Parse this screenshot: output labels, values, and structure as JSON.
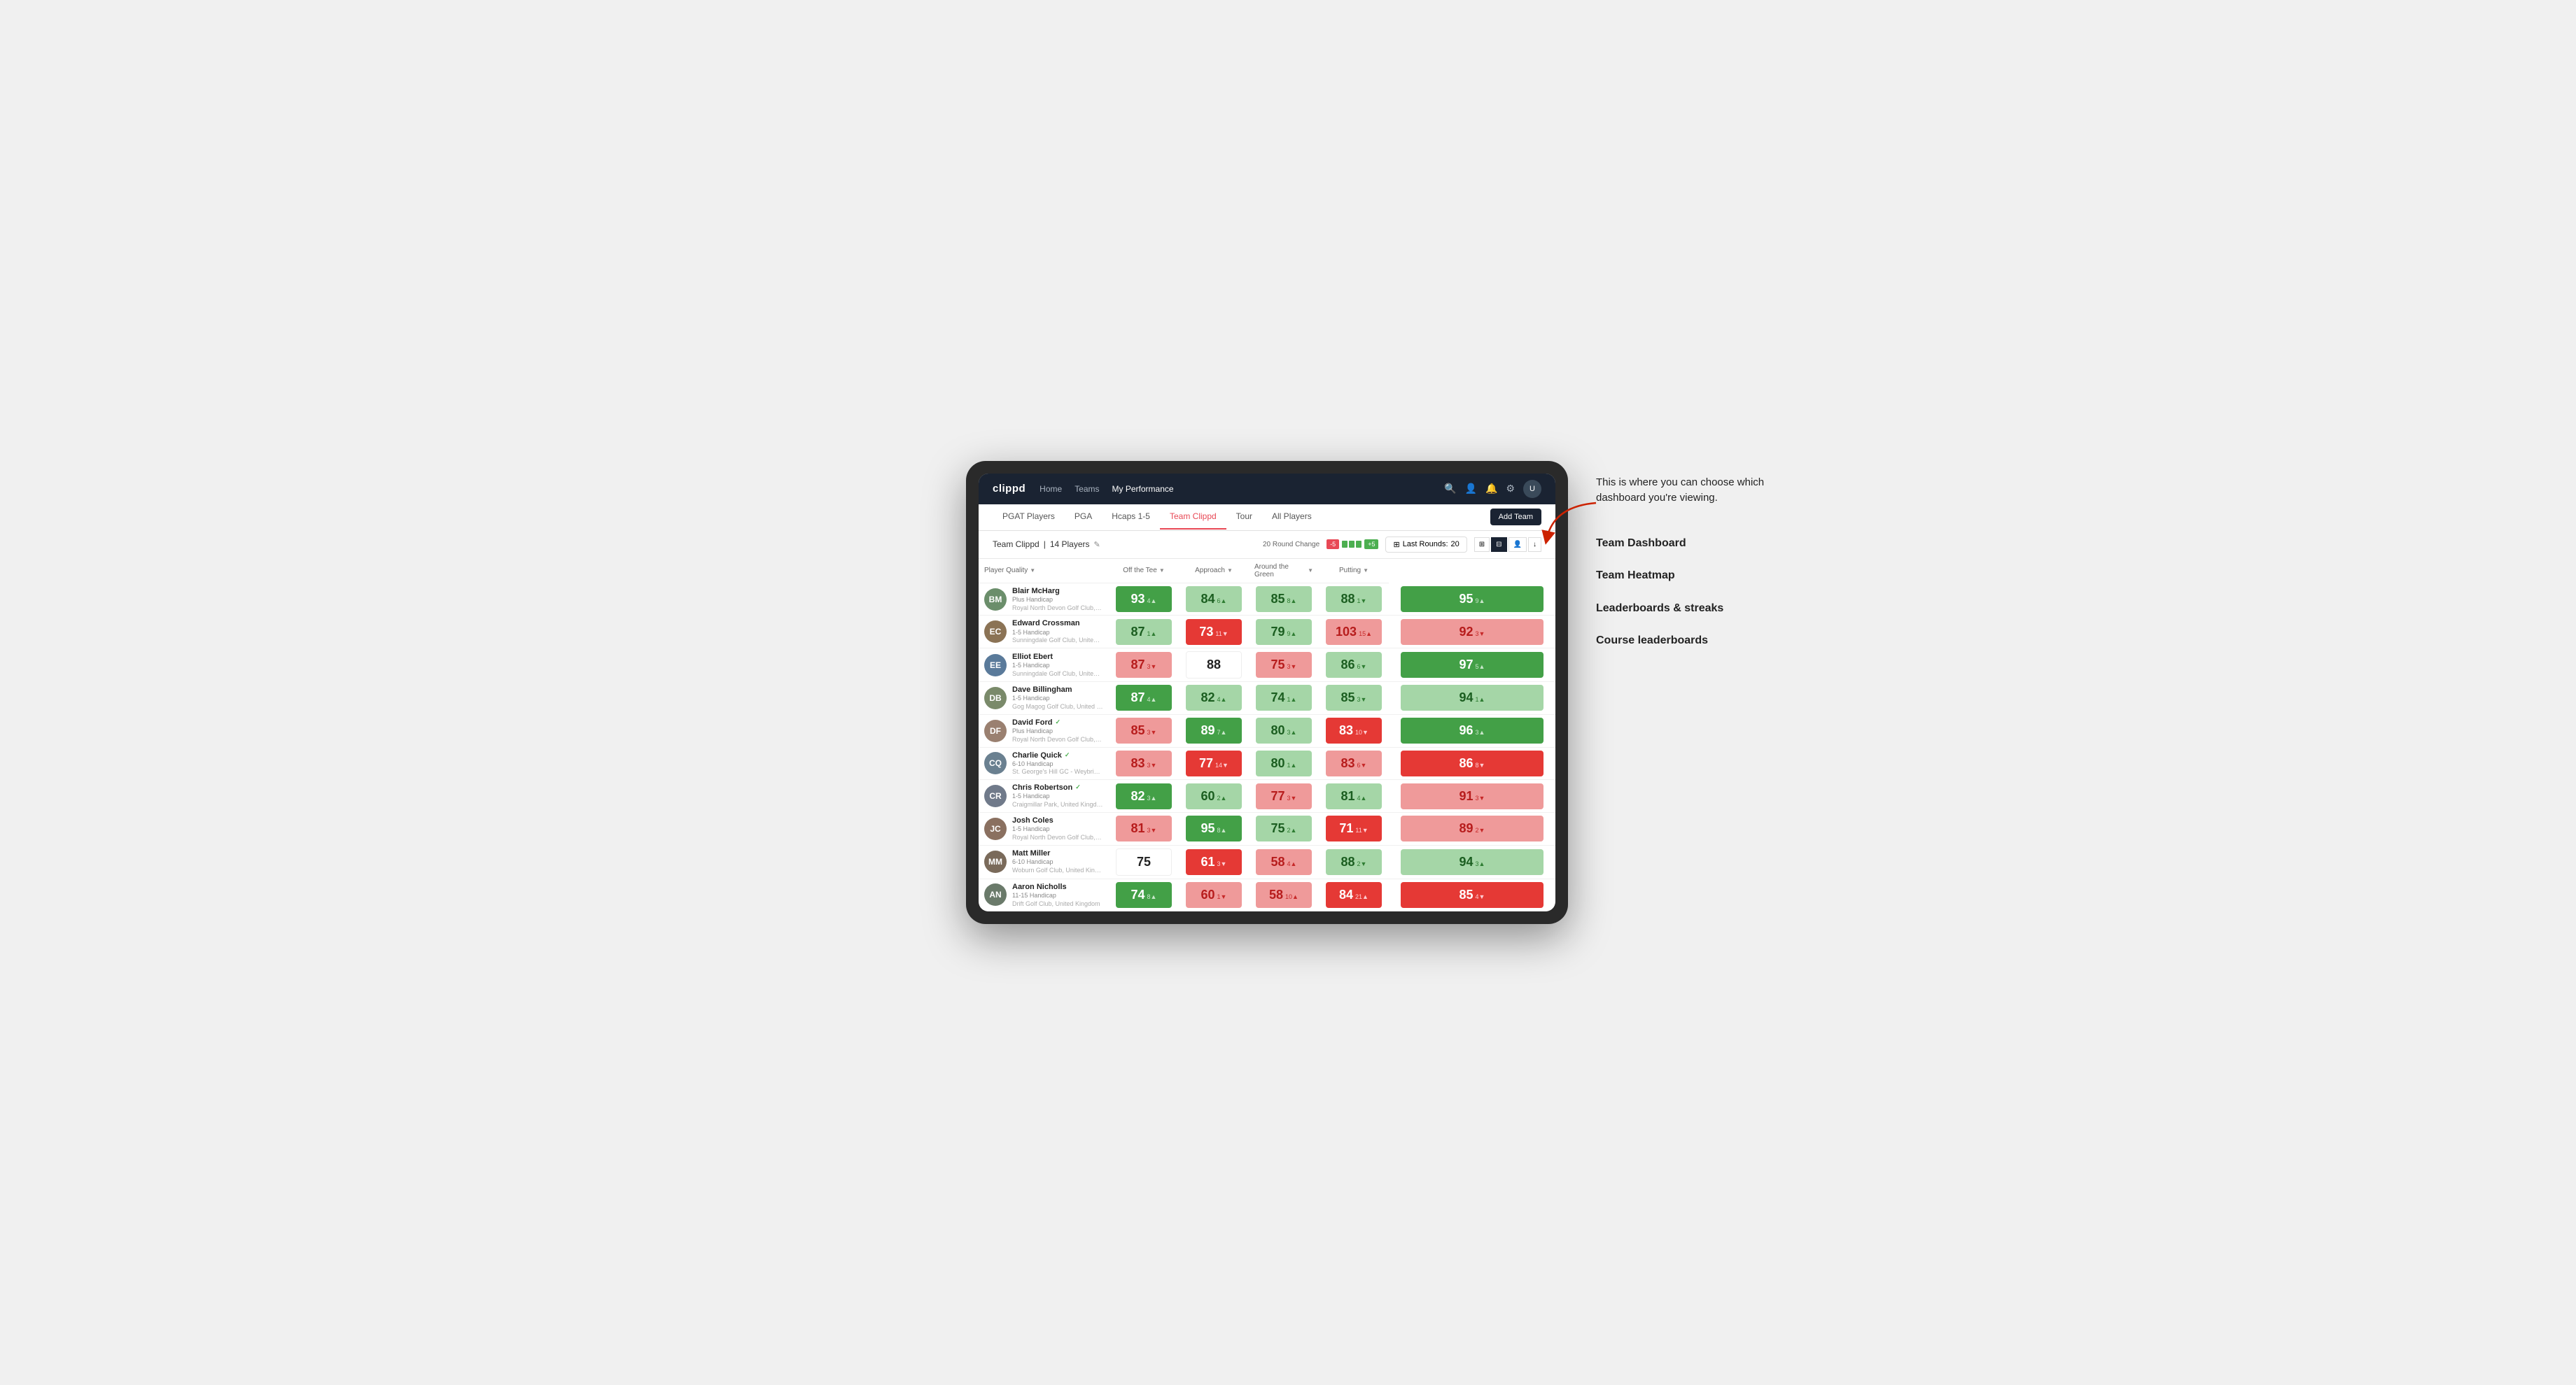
{
  "annotation": {
    "intro_text": "This is where you can choose which dashboard you're viewing.",
    "items": [
      {
        "label": "Team Dashboard"
      },
      {
        "label": "Team Heatmap"
      },
      {
        "label": "Leaderboards & streaks"
      },
      {
        "label": "Course leaderboards"
      }
    ]
  },
  "topnav": {
    "logo": "clippd",
    "links": [
      {
        "label": "Home",
        "active": false
      },
      {
        "label": "Teams",
        "active": false
      },
      {
        "label": "My Performance",
        "active": true
      }
    ]
  },
  "subnav": {
    "links": [
      {
        "label": "PGAT Players",
        "active": false
      },
      {
        "label": "PGA",
        "active": false
      },
      {
        "label": "Hcaps 1-5",
        "active": false
      },
      {
        "label": "Team Clippd",
        "active": true
      },
      {
        "label": "Tour",
        "active": false
      },
      {
        "label": "All Players",
        "active": false
      }
    ],
    "add_team_label": "Add Team"
  },
  "team_row": {
    "name": "Team Clippd",
    "count": "14 Players",
    "round_change_label": "20 Round Change",
    "bar_negative": "-5",
    "bar_positive": "+5",
    "last_rounds_label": "Last Rounds:",
    "last_rounds_value": "20"
  },
  "table": {
    "columns": {
      "player_quality": "Player Quality",
      "off_tee": "Off the Tee",
      "approach": "Approach",
      "around_green": "Around the Green",
      "putting": "Putting"
    },
    "players": [
      {
        "name": "Blair McHarg",
        "handicap": "Plus Handicap",
        "club": "Royal North Devon Golf Club, United Kingdom",
        "avatar_bg": "#6b8e6b",
        "initials": "BM",
        "verified": false,
        "scores": [
          {
            "value": "93",
            "change": "4▲",
            "direction": "up",
            "bg": "bg-green-strong"
          },
          {
            "value": "84",
            "change": "6▲",
            "direction": "up",
            "bg": "bg-green-light"
          },
          {
            "value": "85",
            "change": "8▲",
            "direction": "up",
            "bg": "bg-green-light"
          },
          {
            "value": "88",
            "change": "1▼",
            "direction": "down",
            "bg": "bg-green-light"
          },
          {
            "value": "95",
            "change": "9▲",
            "direction": "up",
            "bg": "bg-green-strong"
          }
        ]
      },
      {
        "name": "Edward Crossman",
        "handicap": "1-5 Handicap",
        "club": "Sunningdale Golf Club, United Kingdom",
        "avatar_bg": "#8b7355",
        "initials": "EC",
        "verified": false,
        "scores": [
          {
            "value": "87",
            "change": "1▲",
            "direction": "up",
            "bg": "bg-green-light"
          },
          {
            "value": "73",
            "change": "11▼",
            "direction": "down",
            "bg": "bg-red-strong"
          },
          {
            "value": "79",
            "change": "9▲",
            "direction": "up",
            "bg": "bg-green-light"
          },
          {
            "value": "103",
            "change": "15▲",
            "direction": "up",
            "bg": "bg-red-light"
          },
          {
            "value": "92",
            "change": "3▼",
            "direction": "down",
            "bg": "bg-red-light"
          }
        ]
      },
      {
        "name": "Elliot Ebert",
        "handicap": "1-5 Handicap",
        "club": "Sunningdale Golf Club, United Kingdom",
        "avatar_bg": "#5a7a9a",
        "initials": "EE",
        "verified": false,
        "scores": [
          {
            "value": "87",
            "change": "3▼",
            "direction": "down",
            "bg": "bg-red-light"
          },
          {
            "value": "88",
            "change": "",
            "direction": "",
            "bg": "bg-white"
          },
          {
            "value": "75",
            "change": "3▼",
            "direction": "down",
            "bg": "bg-red-light"
          },
          {
            "value": "86",
            "change": "6▼",
            "direction": "down",
            "bg": "bg-green-light"
          },
          {
            "value": "97",
            "change": "5▲",
            "direction": "up",
            "bg": "bg-green-strong"
          }
        ]
      },
      {
        "name": "Dave Billingham",
        "handicap": "1-5 Handicap",
        "club": "Gog Magog Golf Club, United Kingdom",
        "avatar_bg": "#7a8a6a",
        "initials": "DB",
        "verified": false,
        "scores": [
          {
            "value": "87",
            "change": "4▲",
            "direction": "up",
            "bg": "bg-green-strong"
          },
          {
            "value": "82",
            "change": "4▲",
            "direction": "up",
            "bg": "bg-green-light"
          },
          {
            "value": "74",
            "change": "1▲",
            "direction": "up",
            "bg": "bg-green-light"
          },
          {
            "value": "85",
            "change": "3▼",
            "direction": "down",
            "bg": "bg-green-light"
          },
          {
            "value": "94",
            "change": "1▲",
            "direction": "up",
            "bg": "bg-green-light"
          }
        ]
      },
      {
        "name": "David Ford",
        "handicap": "Plus Handicap",
        "club": "Royal North Devon Golf Club, United Kingdom",
        "avatar_bg": "#9a8070",
        "initials": "DF",
        "verified": true,
        "scores": [
          {
            "value": "85",
            "change": "3▼",
            "direction": "down",
            "bg": "bg-red-light"
          },
          {
            "value": "89",
            "change": "7▲",
            "direction": "up",
            "bg": "bg-green-strong"
          },
          {
            "value": "80",
            "change": "3▲",
            "direction": "up",
            "bg": "bg-green-light"
          },
          {
            "value": "83",
            "change": "10▼",
            "direction": "down",
            "bg": "bg-red-strong"
          },
          {
            "value": "96",
            "change": "3▲",
            "direction": "up",
            "bg": "bg-green-strong"
          }
        ]
      },
      {
        "name": "Charlie Quick",
        "handicap": "6-10 Handicap",
        "club": "St. George's Hill GC - Weybridge - Surrey, Uni...",
        "avatar_bg": "#6a8090",
        "initials": "CQ",
        "verified": true,
        "scores": [
          {
            "value": "83",
            "change": "3▼",
            "direction": "down",
            "bg": "bg-red-light"
          },
          {
            "value": "77",
            "change": "14▼",
            "direction": "down",
            "bg": "bg-red-strong"
          },
          {
            "value": "80",
            "change": "1▲",
            "direction": "up",
            "bg": "bg-green-light"
          },
          {
            "value": "83",
            "change": "6▼",
            "direction": "down",
            "bg": "bg-red-light"
          },
          {
            "value": "86",
            "change": "8▼",
            "direction": "down",
            "bg": "bg-red-strong"
          }
        ]
      },
      {
        "name": "Chris Robertson",
        "handicap": "1-5 Handicap",
        "club": "Craigmillar Park, United Kingdom",
        "avatar_bg": "#707a8a",
        "initials": "CR",
        "verified": true,
        "scores": [
          {
            "value": "82",
            "change": "3▲",
            "direction": "up",
            "bg": "bg-green-strong"
          },
          {
            "value": "60",
            "change": "2▲",
            "direction": "up",
            "bg": "bg-green-light"
          },
          {
            "value": "77",
            "change": "3▼",
            "direction": "down",
            "bg": "bg-red-light"
          },
          {
            "value": "81",
            "change": "4▲",
            "direction": "up",
            "bg": "bg-green-light"
          },
          {
            "value": "91",
            "change": "3▼",
            "direction": "down",
            "bg": "bg-red-light"
          }
        ]
      },
      {
        "name": "Josh Coles",
        "handicap": "1-5 Handicap",
        "club": "Royal North Devon Golf Club, United Kingdom",
        "avatar_bg": "#8a7060",
        "initials": "JC",
        "verified": false,
        "scores": [
          {
            "value": "81",
            "change": "3▼",
            "direction": "down",
            "bg": "bg-red-light"
          },
          {
            "value": "95",
            "change": "8▲",
            "direction": "up",
            "bg": "bg-green-strong"
          },
          {
            "value": "75",
            "change": "2▲",
            "direction": "up",
            "bg": "bg-green-light"
          },
          {
            "value": "71",
            "change": "11▼",
            "direction": "down",
            "bg": "bg-red-strong"
          },
          {
            "value": "89",
            "change": "2▼",
            "direction": "down",
            "bg": "bg-red-light"
          }
        ]
      },
      {
        "name": "Matt Miller",
        "handicap": "6-10 Handicap",
        "club": "Woburn Golf Club, United Kingdom",
        "avatar_bg": "#7a6a5a",
        "initials": "MM",
        "verified": false,
        "scores": [
          {
            "value": "75",
            "change": "",
            "direction": "",
            "bg": "bg-white"
          },
          {
            "value": "61",
            "change": "3▼",
            "direction": "down",
            "bg": "bg-red-strong"
          },
          {
            "value": "58",
            "change": "4▲",
            "direction": "up",
            "bg": "bg-red-light"
          },
          {
            "value": "88",
            "change": "2▼",
            "direction": "down",
            "bg": "bg-green-light"
          },
          {
            "value": "94",
            "change": "3▲",
            "direction": "up",
            "bg": "bg-green-light"
          }
        ]
      },
      {
        "name": "Aaron Nicholls",
        "handicap": "11-15 Handicap",
        "club": "Drift Golf Club, United Kingdom",
        "avatar_bg": "#6a7a6a",
        "initials": "AN",
        "verified": false,
        "scores": [
          {
            "value": "74",
            "change": "8▲",
            "direction": "up",
            "bg": "bg-green-strong"
          },
          {
            "value": "60",
            "change": "1▼",
            "direction": "down",
            "bg": "bg-red-light"
          },
          {
            "value": "58",
            "change": "10▲",
            "direction": "up",
            "bg": "bg-red-light"
          },
          {
            "value": "84",
            "change": "21▲",
            "direction": "up",
            "bg": "bg-red-strong"
          },
          {
            "value": "85",
            "change": "4▼",
            "direction": "down",
            "bg": "bg-red-strong"
          }
        ]
      }
    ]
  }
}
